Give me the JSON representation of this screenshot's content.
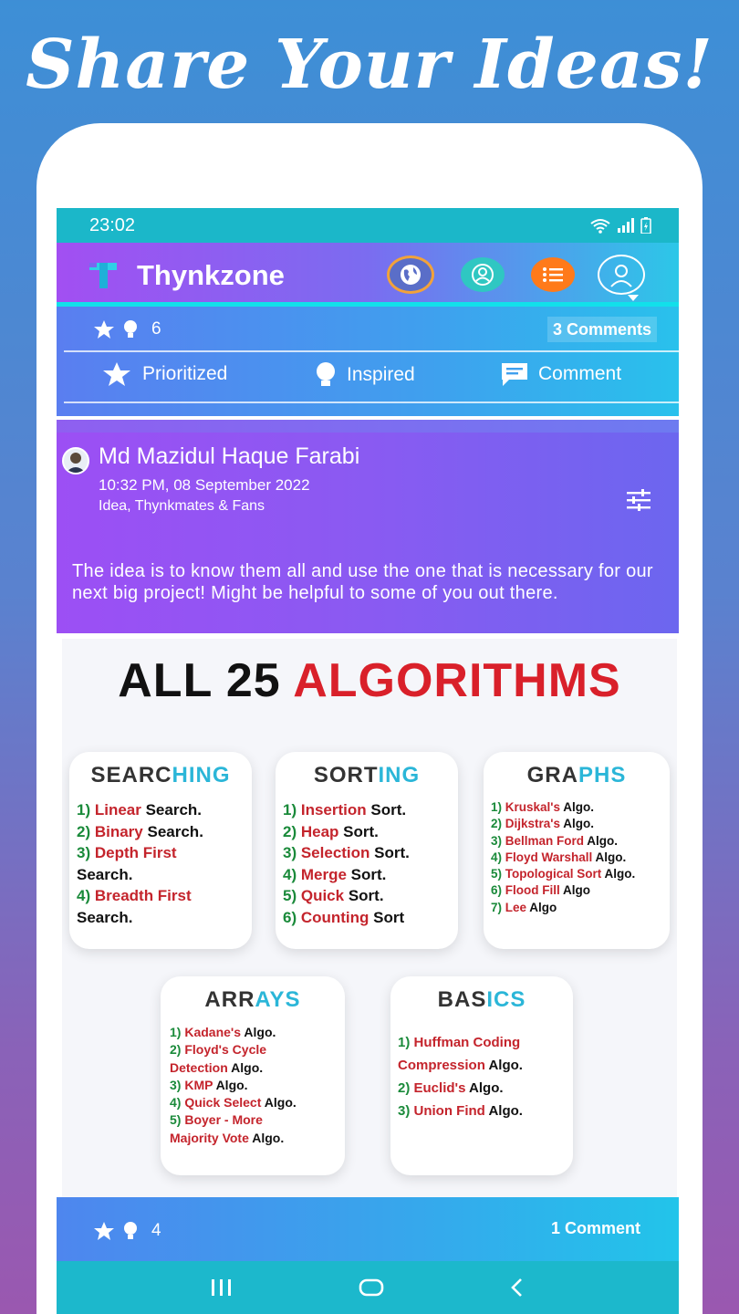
{
  "headline": "Share Your Ideas!",
  "statusbar": {
    "time": "23:02"
  },
  "appbar": {
    "title": "Thynkzone",
    "logo_letter": "T"
  },
  "nav_icons": [
    "globe-icon",
    "people-icon",
    "list-icon",
    "profile-icon"
  ],
  "top_card": {
    "count": "6",
    "comments": "3 Comments",
    "actions": {
      "prioritized": "Prioritized",
      "inspired": "Inspired",
      "comment": "Comment"
    }
  },
  "post": {
    "author": "Md Mazidul Haque Farabi",
    "timestamp": "10:32 PM, 08 September 2022",
    "category": "Idea, Thynkmates & Fans",
    "text": "The idea is to know them all and use the one that is necessary for our next big project! Might be helpful to some of you out there.",
    "image": {
      "title_black": "ALL 25 ",
      "title_red": "ALGORITHMS",
      "sections": {
        "searching": {
          "head_a": "SEARC",
          "head_b": "HING",
          "items": [
            {
              "n": "1) ",
              "hl": "Linear",
              "rest": " Search."
            },
            {
              "n": "2) ",
              "hl": "Binary",
              "rest": " Search."
            },
            {
              "n": "3) ",
              "hl": "Depth First",
              "rest": ""
            },
            {
              "n": "",
              "hl": "",
              "rest": "Search."
            },
            {
              "n": "4) ",
              "hl": "Breadth First",
              "rest": ""
            },
            {
              "n": "",
              "hl": "",
              "rest": "Search."
            }
          ]
        },
        "sorting": {
          "head_a": "SORT",
          "head_b": "ING",
          "items": [
            {
              "n": "1) ",
              "hl": "Insertion",
              "rest": " Sort."
            },
            {
              "n": "2) ",
              "hl": "Heap",
              "rest": " Sort."
            },
            {
              "n": "3) ",
              "hl": "Selection",
              "rest": " Sort."
            },
            {
              "n": "4) ",
              "hl": "Merge",
              "rest": " Sort."
            },
            {
              "n": "5) ",
              "hl": "Quick",
              "rest": " Sort."
            },
            {
              "n": "6) ",
              "hl": "Counting",
              "rest": " Sort"
            }
          ]
        },
        "graphs": {
          "head_a": "GRA",
          "head_b": "PHS",
          "items": [
            {
              "n": "1) ",
              "hl": "Kruskal's",
              "rest": " Algo."
            },
            {
              "n": "2) ",
              "hl": "Dijkstra's",
              "rest": " Algo."
            },
            {
              "n": "3) ",
              "hl": "Bellman Ford",
              "rest": " Algo."
            },
            {
              "n": "4) ",
              "hl": "Floyd Warshall",
              "rest": " Algo."
            },
            {
              "n": "5) ",
              "hl": "Topological Sort",
              "rest": " Algo."
            },
            {
              "n": "6) ",
              "hl": "Flood Fill",
              "rest": " Algo"
            },
            {
              "n": "7) ",
              "hl": "Lee",
              "rest": " Algo"
            }
          ]
        },
        "arrays": {
          "head_a": "ARR",
          "head_b": "AYS",
          "items": [
            {
              "n": "1) ",
              "hl": "Kadane's",
              "rest": " Algo."
            },
            {
              "n": "2) ",
              "hl": "Floyd's  Cycle",
              "rest": ""
            },
            {
              "n": "",
              "hl": "Detection",
              "rest": " Algo."
            },
            {
              "n": "3) ",
              "hl": "KMP",
              "rest": " Algo."
            },
            {
              "n": "4) ",
              "hl": "Quick Select",
              "rest": " Algo."
            },
            {
              "n": "5) ",
              "hl": "Boyer  - More",
              "rest": ""
            },
            {
              "n": "",
              "hl": "Majority Vote",
              "rest": " Algo."
            }
          ]
        },
        "basics": {
          "head_a": "BAS",
          "head_b": "ICS",
          "items": [
            {
              "n": "1) ",
              "hl": "Huffman Coding",
              "rest": ""
            },
            {
              "n": "",
              "hl": "Compression",
              "rest": " Algo."
            },
            {
              "n": "2) ",
              "hl": "Euclid's",
              "rest": " Algo."
            },
            {
              "n": "3) ",
              "hl": "Union Find",
              "rest": " Algo."
            }
          ]
        }
      }
    }
  },
  "bottom_card": {
    "count": "4",
    "comments": "1 Comment"
  }
}
